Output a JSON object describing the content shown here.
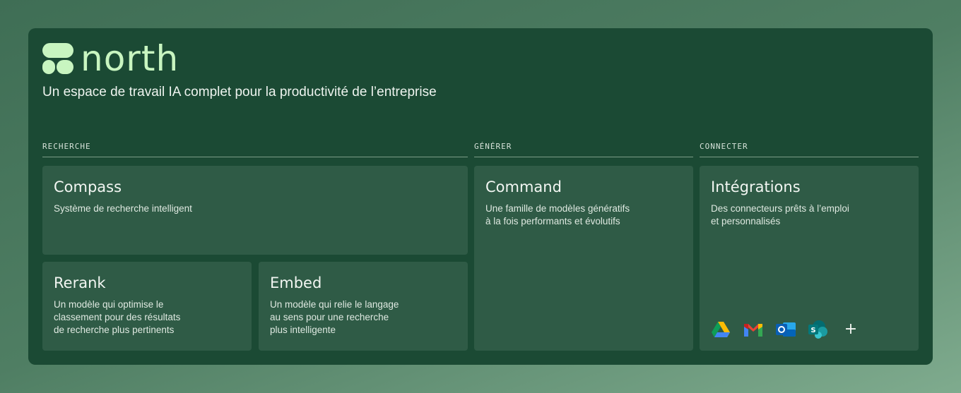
{
  "brand": {
    "name": "north",
    "tagline": "Un espace de travail IA complet pour la productivité de l’entreprise"
  },
  "sections": {
    "search": {
      "label": "RECHERCHE"
    },
    "generate": {
      "label": "GÉNÉRER"
    },
    "connect": {
      "label": "CONNECTER"
    }
  },
  "cards": {
    "compass": {
      "title": "Compass",
      "desc": "Système de recherche intelligent"
    },
    "rerank": {
      "title": "Rerank",
      "desc": "Un modèle qui optimise le\nclassement pour des résultats\nde recherche plus pertinents"
    },
    "embed": {
      "title": "Embed",
      "desc": "Un modèle qui relie le langage\nau sens pour une recherche\nplus intelligente"
    },
    "command": {
      "title": "Command",
      "desc": "Une famille de modèles génératifs\nà la fois performants et évolutifs"
    },
    "integrations": {
      "title": "Intégrations",
      "desc": "Des connecteurs prêts à l’emploi\net personnalisés",
      "icons": [
        "google-drive-icon",
        "gmail-icon",
        "outlook-icon",
        "sharepoint-icon",
        "plus-icon"
      ],
      "plus": "+"
    }
  },
  "colors": {
    "panel": "#1b4a34",
    "card": "#2f5b46",
    "brand": "#c8f5c0"
  }
}
